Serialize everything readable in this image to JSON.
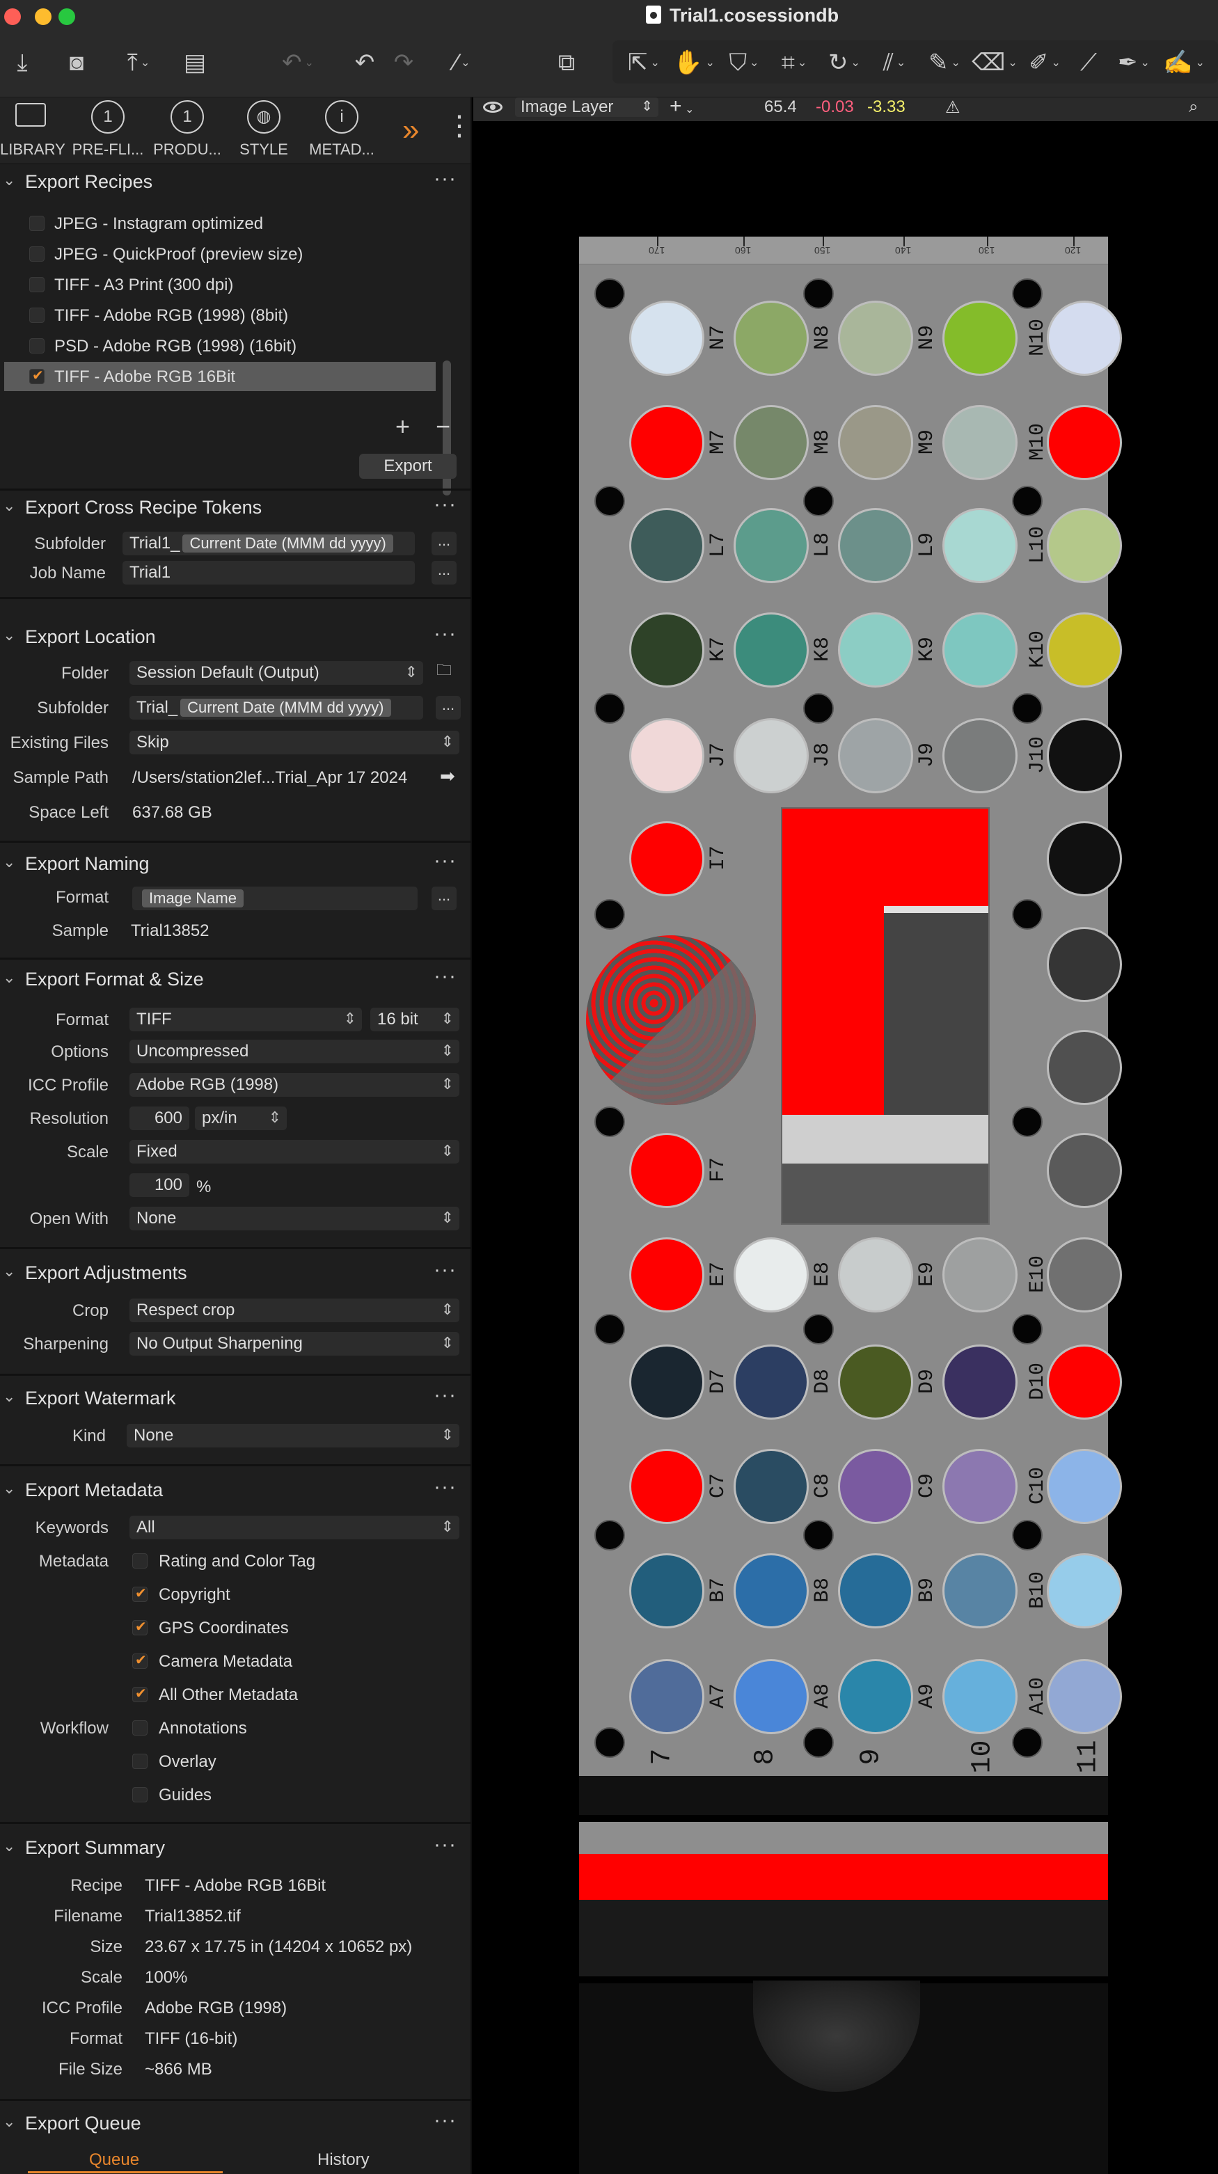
{
  "window": {
    "title": "Trial1.cosessiondb"
  },
  "toolbar": {
    "icons": [
      "import-icon",
      "camera-icon",
      "export-icon",
      "clipboard-icon",
      "undo-history-icon",
      "undo-icon",
      "redo-icon",
      "magic-wand-icon",
      "windows-icon",
      "select-cursor-icon",
      "pan-hand-icon",
      "color-picker-icon",
      "crop-icon",
      "rotate-icon",
      "straighten-icon",
      "brush-icon",
      "eraser-icon",
      "erase-icon",
      "ruler-icon",
      "picker-icon",
      "annotate-icon"
    ]
  },
  "tool_tabs": [
    {
      "label": "LIBRARY"
    },
    {
      "label": "PRE-FLI..."
    },
    {
      "label": "PRODU..."
    },
    {
      "label": "STYLE"
    },
    {
      "label": "METAD..."
    }
  ],
  "export_recipes": {
    "title": "Export Recipes",
    "items": [
      {
        "label": "JPEG - Instagram optimized",
        "checked": false
      },
      {
        "label": "JPEG - QuickProof (preview size)",
        "checked": false
      },
      {
        "label": "TIFF - A3 Print (300 dpi)",
        "checked": false
      },
      {
        "label": "TIFF - Adobe RGB (1998) (8bit)",
        "checked": false
      },
      {
        "label": "PSD - Adobe RGB (1998) (16bit)",
        "checked": false
      },
      {
        "label": "TIFF - Adobe RGB 16Bit",
        "checked": true
      }
    ],
    "export_button": "Export"
  },
  "cross_tokens": {
    "title": "Export Cross Recipe Tokens",
    "subfolder_label": "Subfolder",
    "subfolder_prefix": "Trial1_",
    "subfolder_token": "Current Date (MMM dd yyyy)",
    "jobname_label": "Job Name",
    "jobname_value": "Trial1",
    "more": "..."
  },
  "location": {
    "title": "Export Location",
    "folder_label": "Folder",
    "folder_value": "Session Default (Output)",
    "subfolder_label": "Subfolder",
    "subfolder_prefix": "Trial_",
    "subfolder_token": "Current Date (MMM dd yyyy)",
    "existing_label": "Existing Files",
    "existing_value": "Skip",
    "sample_label": "Sample Path",
    "sample_value": "/Users/station2lef...Trial_Apr 17 2024",
    "space_label": "Space Left",
    "space_value": "637.68 GB"
  },
  "naming": {
    "title": "Export Naming",
    "format_label": "Format",
    "format_token": "Image Name",
    "sample_label": "Sample",
    "sample_value": "Trial13852"
  },
  "format_size": {
    "title": "Export Format & Size",
    "format_label": "Format",
    "format_value": "TIFF",
    "bit_value": "16 bit",
    "options_label": "Options",
    "options_value": "Uncompressed",
    "icc_label": "ICC Profile",
    "icc_value": "Adobe RGB (1998)",
    "resolution_label": "Resolution",
    "resolution_value": "600",
    "resolution_unit": "px/in",
    "scale_label": "Scale",
    "scale_value": "Fixed",
    "scale_amount": "100",
    "scale_unit": "%",
    "openwith_label": "Open With",
    "openwith_value": "None"
  },
  "adjustments": {
    "title": "Export Adjustments",
    "crop_label": "Crop",
    "crop_value": "Respect crop",
    "sharpen_label": "Sharpening",
    "sharpen_value": "No Output Sharpening"
  },
  "watermark": {
    "title": "Export Watermark",
    "kind_label": "Kind",
    "kind_value": "None"
  },
  "metadata": {
    "title": "Export Metadata",
    "keywords_label": "Keywords",
    "keywords_value": "All",
    "metadata_label": "Metadata",
    "items": [
      {
        "label": "Rating and Color Tag",
        "checked": false
      },
      {
        "label": "Copyright",
        "checked": true
      },
      {
        "label": "GPS Coordinates",
        "checked": true
      },
      {
        "label": "Camera Metadata",
        "checked": true
      },
      {
        "label": "All Other Metadata",
        "checked": true
      }
    ],
    "workflow_label": "Workflow",
    "workflow_items": [
      {
        "label": "Annotations",
        "checked": false
      },
      {
        "label": "Overlay",
        "checked": false
      },
      {
        "label": "Guides",
        "checked": false
      }
    ]
  },
  "summary": {
    "title": "Export Summary",
    "rows": [
      {
        "label": "Recipe",
        "value": "TIFF - Adobe RGB 16Bit"
      },
      {
        "label": "Filename",
        "value": "Trial13852.tif"
      },
      {
        "label": "Size",
        "value": "23.67 x 17.75 in (14204 x 10652 px)"
      },
      {
        "label": "Scale",
        "value": "100%"
      },
      {
        "label": "ICC Profile",
        "value": "Adobe RGB (1998)"
      },
      {
        "label": "Format",
        "value": "TIFF (16-bit)"
      },
      {
        "label": "File Size",
        "value": "~866 MB"
      }
    ]
  },
  "queue": {
    "title": "Export Queue",
    "tabs": [
      "Queue",
      "History"
    ],
    "active_tab": "Queue"
  },
  "viewer": {
    "layer": "Image Layer",
    "readout_l": "65.4",
    "readout_a": "-0.03",
    "readout_b": "-3.33",
    "readout_a_color": "#ff5f7e",
    "readout_b_color": "#f4f06a"
  },
  "target": {
    "ruler_labels": [
      "170",
      "160",
      "150",
      "140",
      "130",
      "120"
    ],
    "columns": [
      "7",
      "8",
      "9",
      "10",
      "11"
    ],
    "row_labels": [
      [
        "N7",
        "N8",
        "N9",
        "N10"
      ],
      [
        "M7",
        "M8",
        "M9",
        "M10"
      ],
      [
        "L7",
        "L8",
        "L9",
        "L10"
      ],
      [
        "K7",
        "K8",
        "K9",
        "K10"
      ],
      [
        "J7",
        "J8",
        "J9",
        "J10"
      ],
      [
        "I7"
      ],
      [
        "F7"
      ],
      [
        "E7",
        "E8",
        "E9",
        "E10"
      ],
      [
        "D7",
        "D8",
        "D9",
        "D10"
      ],
      [
        "C7",
        "C8",
        "C9",
        "C10"
      ],
      [
        "B7",
        "B8",
        "B9",
        "B10"
      ],
      [
        "A7",
        "A8",
        "A9",
        "A10"
      ]
    ],
    "chip_colors": [
      [
        "#d6e2ee",
        "#8ca866",
        "#a9b69a",
        "#84bc2a",
        "#d4dcef"
      ],
      [
        "#ff0000",
        "#76886a",
        "#9a9888",
        "#a8b8b2",
        "#ff0000"
      ],
      [
        "#3e5c5a",
        "#5c9c8c",
        "#6c908a",
        "#a8d8d2",
        "#b4c88a"
      ],
      [
        "#2e4228",
        "#3c8c7c",
        "#8ccdc4",
        "#7ec7c0",
        "#c8be28"
      ],
      [
        "#f0d8d8",
        "#ccd0d0",
        "#9ea4a6",
        "#7a7c7c",
        "#111111"
      ],
      [
        "#ff0000",
        "",
        "",
        "",
        "#111111"
      ],
      [
        "",
        "",
        "",
        "",
        "#353535"
      ],
      [
        "",
        "",
        "",
        "",
        "#505050"
      ],
      [
        "#ff0000",
        "",
        "",
        "",
        "#5a5a5a"
      ],
      [
        "#ff0000",
        "#e8ecec",
        "#c8cccc",
        "#9ea0a0",
        "#707070"
      ],
      [
        "#1a2630",
        "#2c3e62",
        "#4a5a22",
        "#3a3060",
        "#ff0000"
      ],
      [
        "#ff0000",
        "#2a4c62",
        "#7a5aa0",
        "#8c78b0",
        "#8cb4e8"
      ],
      [
        "#225e7c",
        "#2c6ea8",
        "#266c98",
        "#5884a4",
        "#96ccea"
      ],
      [
        "#506c9a",
        "#4a86d8",
        "#2a86aa",
        "#66b0dc",
        "#92a8d4"
      ]
    ]
  }
}
